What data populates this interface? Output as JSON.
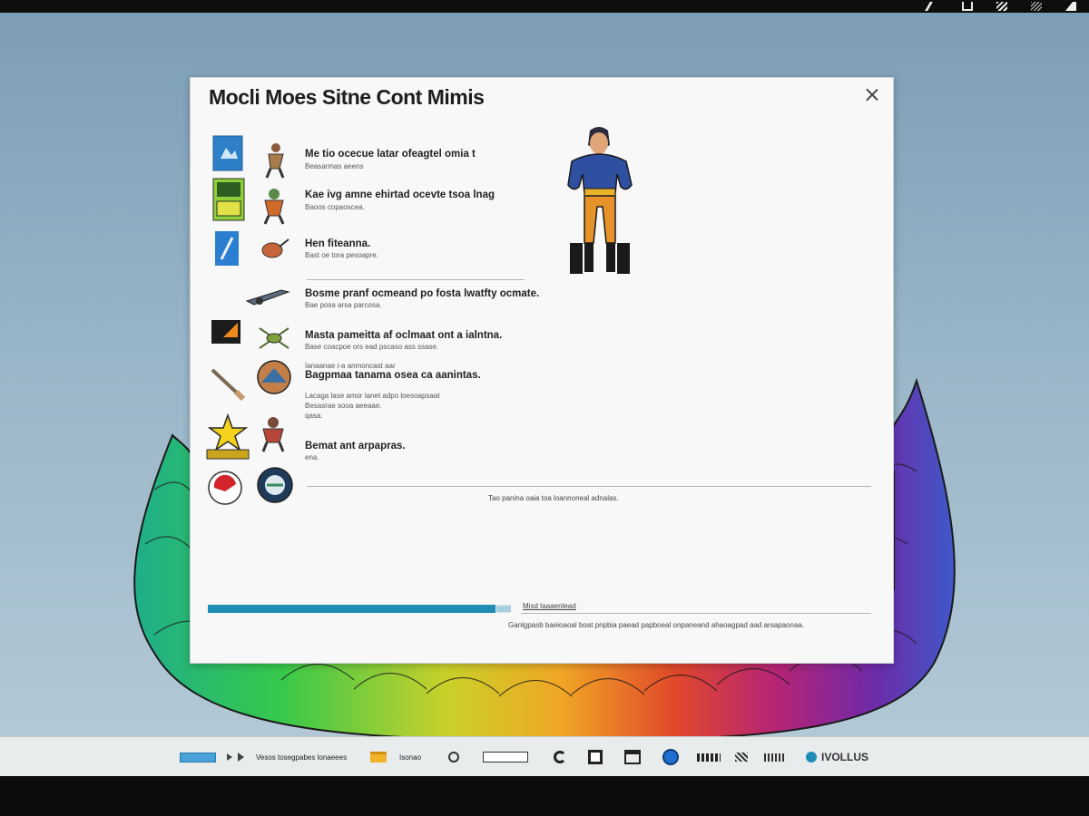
{
  "window": {
    "title": "Mocli Moes Sitne Cont Mimis"
  },
  "items": [
    {
      "title": "Me tio ocecue latar ofeagtel omia t",
      "sub": "Beasarmas aeens"
    },
    {
      "title": "Kae ivg amne ehirtad ocevte tsoa lnag",
      "sub": "Baoos copaoscea."
    },
    {
      "title": "Hen fiteanna.",
      "sub": "Bast oe tora pesoapre."
    },
    {
      "title": "Bosme pranf ocmeand po fosta lwatfty ocmate.",
      "sub": "Bae posa arsa parcosa."
    },
    {
      "title": "Masta pameitta af oclmaat ont a ialntna.",
      "sub": "Base coacpoe ors ead pscaso ass ssase."
    },
    {
      "title": "Bagpmaa tanama osea ca aanintas.",
      "sub": "Ianaanae i-a anmoncast aar"
    },
    {
      "title": "Bemat ant arpapras.",
      "sub": "ena."
    }
  ],
  "extra_paragraph": [
    "Lacaga lase amor lanet adpo loesoapsaat",
    "Besasrae sooa aeeaae.",
    "qasa."
  ],
  "divider_note": "Tao panina oaia toa loannoneal adnalas.",
  "progress": {
    "label": "Misd taaaenlead",
    "footer": "Ganlgpasb baeioaoal boat pnpbia paead papboeal onpaneand ahaoagpad aad arsapaonaa.",
    "percent": 0.95
  },
  "taskbar": {
    "text1": "Vesos tosegpabes lonaeees",
    "text2": "Isonao",
    "brand": "IVOLLUS"
  },
  "colors": {
    "accent": "#1f8fb6",
    "dialog_bg": "#f7f8f7",
    "taskbar_bg": "#e9ecec"
  }
}
